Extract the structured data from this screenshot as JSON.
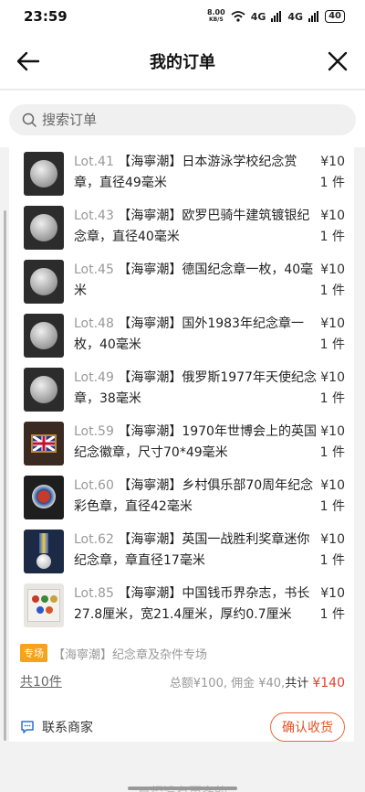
{
  "status": {
    "time": "23:59",
    "net_speed": "8.00",
    "net_unit": "KB/S",
    "wifi": "wifi-icon",
    "signal1": "4G",
    "signal2": "4G",
    "battery": "40"
  },
  "nav": {
    "title": "我的订单"
  },
  "search": {
    "placeholder": "搜索订单"
  },
  "items": [
    {
      "lot": "Lot.41",
      "title": "【海寧潮】日本游泳学校纪念赏章，直径49毫米",
      "price": "¥10",
      "qty": "1 件"
    },
    {
      "lot": "Lot.43",
      "title": "【海寧潮】欧罗巴骑牛建筑镀银纪念章，直径40毫米",
      "price": "¥10",
      "qty": "1 件"
    },
    {
      "lot": "Lot.45",
      "title": "【海寧潮】德国纪念章一枚，40毫米",
      "price": "¥10",
      "qty": "1 件"
    },
    {
      "lot": "Lot.48",
      "title": "【海寧潮】国外1983年纪念章一枚，40毫米",
      "price": "¥10",
      "qty": "1 件"
    },
    {
      "lot": "Lot.49",
      "title": "【海寧潮】俄罗斯1977年天使纪念章，38毫米",
      "price": "¥10",
      "qty": "1 件"
    },
    {
      "lot": "Lot.59",
      "title": "【海寧潮】1970年世博会上的英国纪念徽章，尺寸70*49毫米",
      "price": "¥10",
      "qty": "1 件"
    },
    {
      "lot": "Lot.60",
      "title": "【海寧潮】乡村俱乐部70周年纪念彩色章，直径42毫米",
      "price": "¥10",
      "qty": "1 件"
    },
    {
      "lot": "Lot.62",
      "title": "【海寧潮】英国一战胜利奖章迷你纪念章，章直径17毫米",
      "price": "¥10",
      "qty": "1 件"
    },
    {
      "lot": "Lot.85",
      "title": "【海寧潮】中国钱币界杂志，书长27.8厘米，宽21.4厘米，厚约0.7厘米",
      "price": "¥10",
      "qty": "1 件"
    }
  ],
  "order": {
    "special_tag": "专场",
    "special_name": "【海寧潮】纪念章及杂件专场",
    "count": "共10件",
    "summary": "总额¥100, 佣金 ¥40,",
    "total_label": "共计",
    "total_value": "¥140",
    "contact": "联系商家",
    "confirm": "确认收货"
  },
  "footer": {
    "note": "已经没有更多的"
  }
}
